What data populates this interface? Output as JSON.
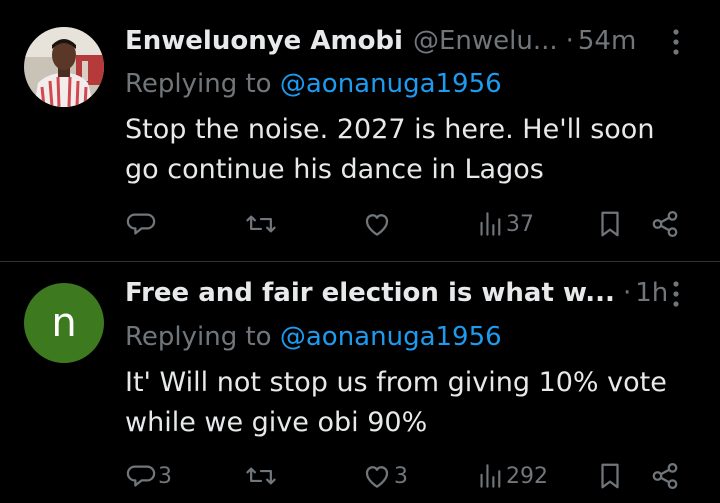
{
  "colors": {
    "background": "#000000",
    "text": "#e7e9ea",
    "muted": "#71767b",
    "link": "#1d9bf0",
    "divider": "#2f3336",
    "avatar_letter_bg": "#3d7a1f"
  },
  "tweets": [
    {
      "author_name": "Enweluonye Amobi",
      "handle": "@Enwelu...",
      "dot": "·",
      "time": "54m",
      "replying_prefix": "Replying to",
      "replying_to": "@aonanuga1956",
      "text_lines": [
        "Stop the noise. 2027 is here.  He'll soon",
        "go continue his dance in Lagos"
      ],
      "avatar": "photo",
      "icons": [
        "reply-icon",
        "retweet-icon",
        "like-icon",
        "views-icon",
        "bookmark-icon",
        "share-icon"
      ],
      "counts": {
        "replies": "",
        "retweets": "",
        "likes": "",
        "views": "37"
      }
    },
    {
      "author_name": "Free and fair election is what w...",
      "handle": "",
      "dot": "·",
      "time": "1h",
      "replying_prefix": "Replying to",
      "replying_to": "@aonanuga1956",
      "text_lines": [
        "It' Will not stop us from giving 10% vote",
        "while we give obi 90%"
      ],
      "avatar": "letter",
      "avatar_letter": "n",
      "icons": [
        "reply-icon",
        "retweet-icon",
        "like-icon",
        "views-icon",
        "bookmark-icon",
        "share-icon"
      ],
      "counts": {
        "replies": "3",
        "retweets": "",
        "likes": "3",
        "views": "292"
      }
    }
  ]
}
